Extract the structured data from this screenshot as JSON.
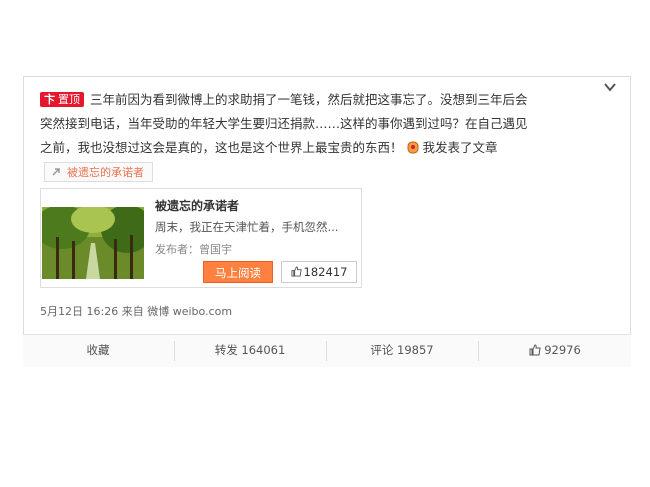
{
  "post": {
    "badge_icon": "卞",
    "badge_label": "置顶",
    "text_line1": "三年前因为看到微博上的求助捐了一笔钱，然后就把这事忘了。没想到三年后会",
    "text_line2": "突然接到电话，当年受助的年轻大学生要归还捐款……这样的事你遇到过吗？在自己遇见",
    "text_line3_a": "之前，我也没想过这会是真的，这也是这个世界上最宝贵的东西！",
    "text_line3_b": "我发表了文章",
    "tag_label": "被遗忘的承诺者",
    "timestamp": "5月12日 16:26",
    "source_prefix": "来自",
    "source": "微博 weibo.com"
  },
  "article": {
    "title": "被遗忘的承诺者",
    "summary": "周末，我正在天津忙着，手机忽然...",
    "author": "发布者：曾国宇",
    "read_button": "马上阅读",
    "like_count": "182417"
  },
  "actions": {
    "favorite": "收藏",
    "repost_label": "转发",
    "repost_count": "164061",
    "comment_label": "评论",
    "comment_count": "19857",
    "like_count": "92976"
  },
  "colors": {
    "badge_red": "#e6162d",
    "link_orange": "#eb7350",
    "button_orange": "#ff8140"
  },
  "icons": [
    "chevron-down-icon",
    "link-icon",
    "thumb-up-icon"
  ]
}
